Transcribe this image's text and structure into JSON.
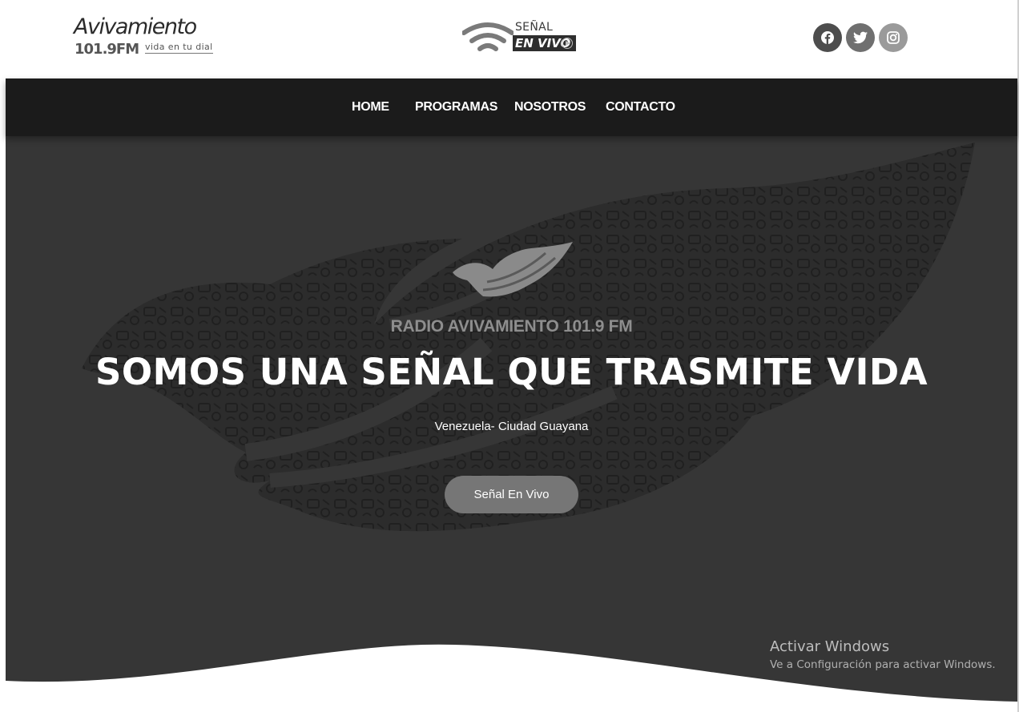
{
  "header": {
    "logo": {
      "title": "Avivamiento",
      "frequency": "101.9FM",
      "tagline": "vida en tu dial"
    },
    "live_signal": {
      "top_text": "SEÑAL",
      "box_text": "EN VIVO"
    },
    "social": [
      {
        "name": "facebook",
        "icon": "facebook-icon"
      },
      {
        "name": "twitter",
        "icon": "twitter-icon"
      },
      {
        "name": "instagram",
        "icon": "instagram-icon"
      }
    ]
  },
  "nav": {
    "items": [
      {
        "label": "HOME"
      },
      {
        "label": "PROGRAMAS"
      },
      {
        "label": "NOSOTROS"
      },
      {
        "label": "CONTACTO"
      }
    ]
  },
  "hero": {
    "subtitle": "RADIO AVIVAMIENTO 101.9 FM",
    "title": "SOMOS UNA SEÑAL QUE TRASMITE VIDA",
    "location": "Venezuela- Ciudad Guayana",
    "button_label": "Señal En Vivo"
  },
  "watermark": {
    "line1": "Activar Windows",
    "line2": "Ve a Configuración para activar Windows."
  },
  "colors": {
    "nav_bg": "#1b1b1b",
    "hero_bg": "#363636",
    "button_bg": "#767676"
  }
}
